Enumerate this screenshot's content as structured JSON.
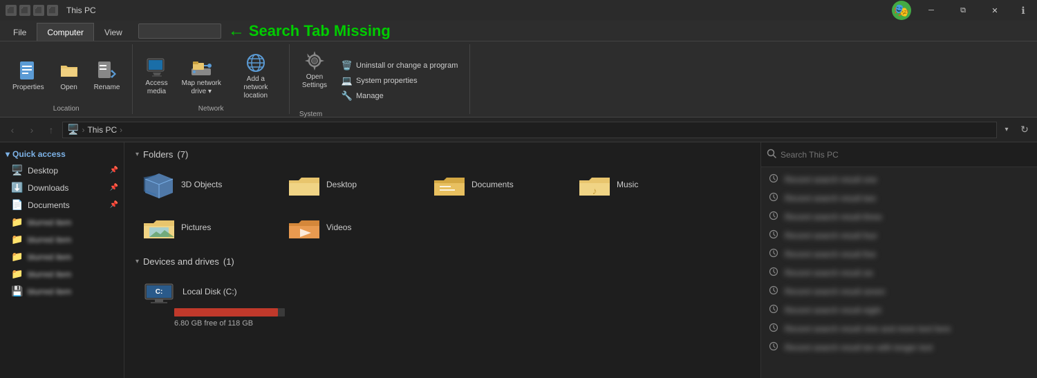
{
  "titleBar": {
    "title": "This PC",
    "icons": [
      "minimize",
      "restore",
      "close"
    ],
    "minimizeLabel": "─",
    "restoreLabel": "⧉",
    "closeLabel": "✕",
    "userAvatarAlt": "user-avatar"
  },
  "ribbonTabs": [
    {
      "id": "file",
      "label": "File"
    },
    {
      "id": "computer",
      "label": "Computer",
      "active": true
    },
    {
      "id": "view",
      "label": "View"
    }
  ],
  "annotation": {
    "arrowText": "←",
    "label": "Search Tab Missing"
  },
  "ribbon": {
    "groups": [
      {
        "id": "location",
        "label": "Location",
        "buttons": [
          {
            "id": "properties",
            "label": "Properties",
            "icon": "🔷"
          },
          {
            "id": "open",
            "label": "Open",
            "icon": "📂"
          },
          {
            "id": "rename",
            "label": "Rename",
            "icon": "✏️"
          }
        ]
      },
      {
        "id": "network",
        "label": "Network",
        "buttons": [
          {
            "id": "access-media",
            "label": "Access\nmedia",
            "icon": "🖥️"
          },
          {
            "id": "map-network-drive",
            "label": "Map network\ndrive",
            "icon": "🗺️"
          },
          {
            "id": "add-network-location",
            "label": "Add a network\nlocation",
            "icon": "🌐"
          }
        ]
      },
      {
        "id": "system",
        "label": "System",
        "buttons": [
          {
            "id": "open-settings",
            "label": "Open\nSettings",
            "icon": "⚙️"
          }
        ],
        "smallButtons": [
          {
            "id": "uninstall",
            "label": "Uninstall or change a program",
            "icon": "🗑️"
          },
          {
            "id": "system-properties",
            "label": "System properties",
            "icon": "💻"
          },
          {
            "id": "manage",
            "label": "Manage",
            "icon": "🔧"
          }
        ]
      }
    ]
  },
  "addressBar": {
    "back": "‹",
    "forward": "›",
    "up": "↑",
    "pathIcon": "🖥️",
    "pathParts": [
      "This PC"
    ],
    "dropdown": "▾",
    "refresh": "↻"
  },
  "sidebar": {
    "quickAccessLabel": "Quick access",
    "items": [
      {
        "id": "desktop",
        "label": "Desktop",
        "icon": "🖥️",
        "pinned": true,
        "blurred": false
      },
      {
        "id": "downloads",
        "label": "Downloads",
        "icon": "⬇️",
        "pinned": true,
        "blurred": false
      },
      {
        "id": "documents",
        "label": "Documents",
        "icon": "📄",
        "pinned": true,
        "blurred": false
      },
      {
        "id": "blurred1",
        "label": "blurred item 1",
        "icon": "📁",
        "pinned": false,
        "blurred": true
      },
      {
        "id": "blurred2",
        "label": "blurred item 2",
        "icon": "📁",
        "pinned": false,
        "blurred": true
      },
      {
        "id": "blurred3",
        "label": "blurred item 3",
        "icon": "📁",
        "pinned": false,
        "blurred": true
      },
      {
        "id": "blurred4",
        "label": "blurred item 4",
        "icon": "📁",
        "pinned": false,
        "blurred": true
      },
      {
        "id": "blurred5",
        "label": "blurred item 5",
        "icon": "💾",
        "pinned": false,
        "blurred": true
      }
    ]
  },
  "content": {
    "foldersSection": {
      "label": "Folders",
      "count": "(7)",
      "folders": [
        {
          "id": "3d-objects",
          "name": "3D Objects",
          "iconType": "folder-blue"
        },
        {
          "id": "desktop",
          "name": "Desktop",
          "iconType": "folder-yellow"
        },
        {
          "id": "documents",
          "name": "Documents",
          "iconType": "folder-docs"
        },
        {
          "id": "music",
          "name": "Music",
          "iconType": "folder-yellow"
        },
        {
          "id": "pictures",
          "name": "Pictures",
          "iconType": "folder-yellow"
        },
        {
          "id": "videos",
          "name": "Videos",
          "iconType": "folder-orange"
        }
      ]
    },
    "devicesSection": {
      "label": "Devices and drives",
      "count": "(1)",
      "devices": [
        {
          "id": "local-disk-c",
          "name": "Local Disk (C:)",
          "freeSpace": "6.80 GB free of 118 GB",
          "usedPercent": 94,
          "iconColor": "#5b9bd5"
        }
      ]
    }
  },
  "searchPanel": {
    "placeholder": "Search This PC",
    "results": [
      {
        "id": "r1",
        "text": "xxxxxxxxxxxxxxxx"
      },
      {
        "id": "r2",
        "text": "xxxxxxxxxxxxxxxx"
      },
      {
        "id": "r3",
        "text": "xxxxxxxxxxxxxxxx"
      },
      {
        "id": "r4",
        "text": "xxxxxxxxxxxxxxxx"
      },
      {
        "id": "r5",
        "text": "xxxxxxxxxxxxxxxx"
      },
      {
        "id": "r6",
        "text": "xxxxxxxxxxxxxxxx"
      },
      {
        "id": "r7",
        "text": "xxxxxxxxxxxxxxxx"
      },
      {
        "id": "r8",
        "text": "xxxxxxxxxxxxxxxx"
      },
      {
        "id": "r9",
        "text": "xxxxxxxxxxxxxxxx"
      },
      {
        "id": "r10",
        "text": "xxxxxxxxxxxxxxxx"
      }
    ]
  },
  "colors": {
    "accent": "#5b9bd5",
    "progressRed": "#c0392b",
    "annotationGreen": "#00cc00",
    "sidebarBlue": "#4a90d9"
  }
}
